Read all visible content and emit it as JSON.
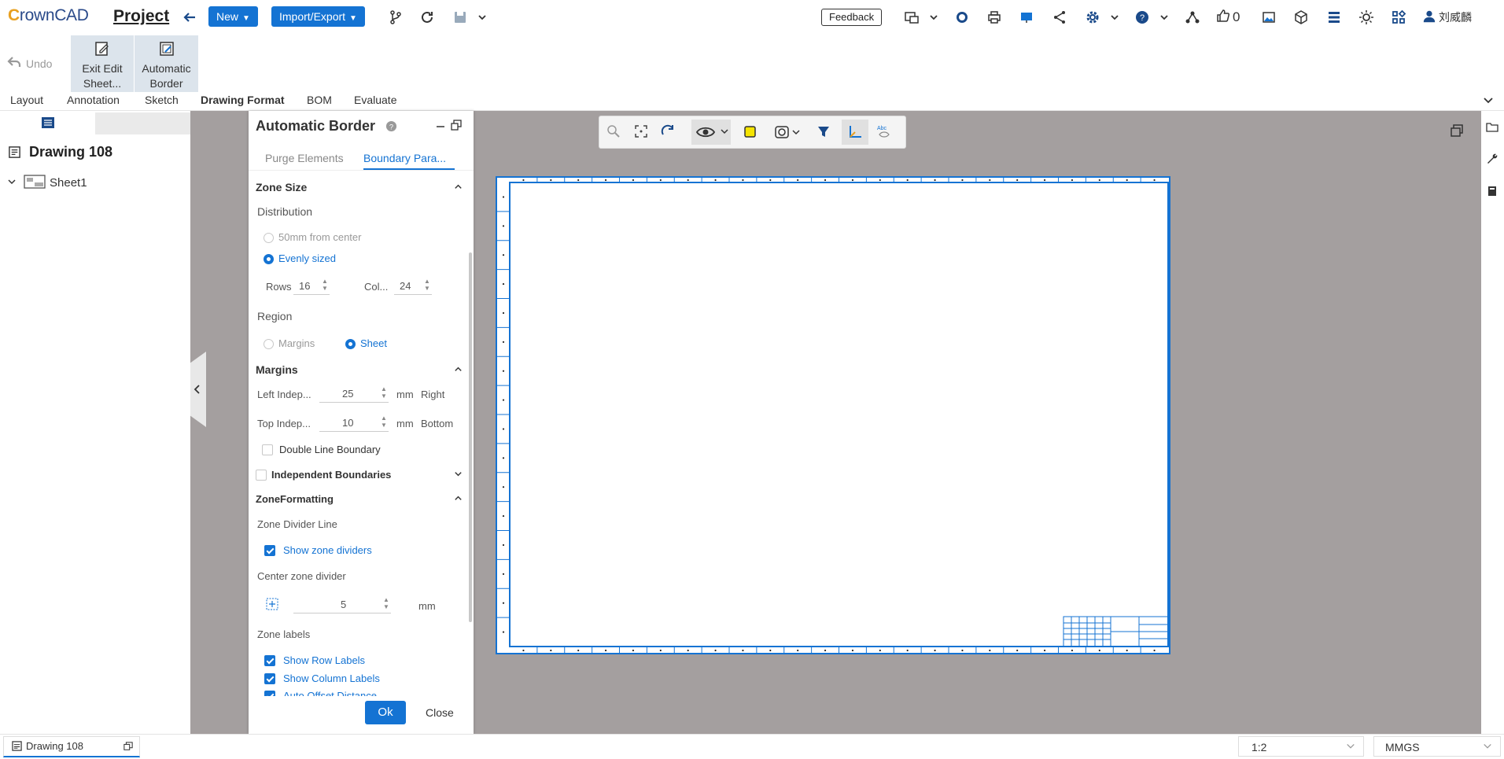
{
  "header": {
    "logo_prefix": "C",
    "logo_rest": "rownCAD",
    "project_title": "Project",
    "new_label": "New",
    "import_export_label": "Import/Export",
    "feedback_label": "Feedback",
    "likes_count": "0",
    "user_name": "刘威麟"
  },
  "ribbon": {
    "undo_label": "Undo",
    "exit_edit_label": "Exit Edit Sheet...",
    "auto_border_label": "Automatic Border"
  },
  "tabs": [
    "Layout",
    "Annotation",
    "Sketch",
    "Drawing Format",
    "BOM",
    "Evaluate"
  ],
  "active_tab": "Drawing Format",
  "tree": {
    "drawing_name": "Drawing 108",
    "sheet_name": "Sheet1"
  },
  "panel": {
    "title": "Automatic Border",
    "tab_purge": "Purge Elements",
    "tab_boundary": "Boundary Para...",
    "zone_size": "Zone Size",
    "distribution": "Distribution",
    "opt_50mm": "50mm from center",
    "opt_even": "Evenly sized",
    "rows_label": "Rows",
    "rows_value": "16",
    "cols_label": "Col...",
    "cols_value": "24",
    "region": "Region",
    "opt_margins": "Margins",
    "opt_sheet": "Sheet",
    "margins_section": "Margins",
    "left_label": "Left Indep...",
    "left_value": "25",
    "mm1": "mm",
    "right_label": "Right",
    "top_label": "Top Indep...",
    "top_value": "10",
    "mm2": "mm",
    "bottom_label": "Bottom",
    "double_line": "Double Line Boundary",
    "independent": "Independent Boundaries",
    "zone_formatting": "ZoneFormatting",
    "zone_divider_line": "Zone Divider Line",
    "show_zone_dividers": "Show zone dividers",
    "center_zone_divider": "Center zone divider",
    "center_value": "5",
    "mm3": "mm",
    "zone_labels": "Zone labels",
    "show_row_labels": "Show Row Labels",
    "show_col_labels": "Show Column Labels",
    "auto_offset": "Auto Offset Distance",
    "ok_label": "Ok",
    "close_label": "Close"
  },
  "statusbar": {
    "doc_tab": "Drawing 108",
    "scale": "1:2",
    "units": "MMGS"
  },
  "colors": {
    "accent": "#1473d3",
    "canvas": "#a49f9f"
  }
}
